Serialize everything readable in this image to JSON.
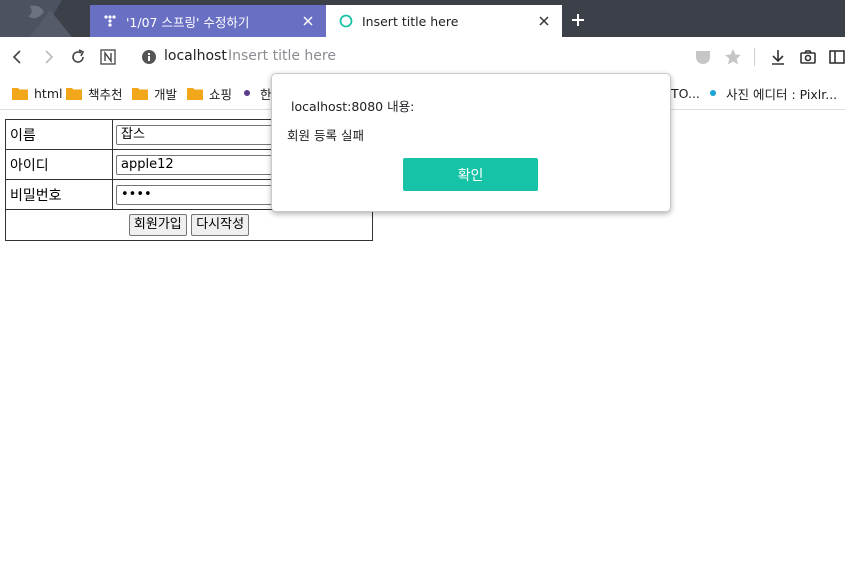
{
  "browser": {
    "tabs": [
      {
        "title": "'1/07 스프링' 수정하기",
        "active": false
      },
      {
        "title": "Insert title here",
        "active": true
      }
    ],
    "address": {
      "host": "localhost",
      "title": "Insert title here"
    },
    "bookmarks": [
      {
        "label": "html",
        "type": "folder"
      },
      {
        "label": "책추천",
        "type": "folder"
      },
      {
        "label": "개발",
        "type": "folder"
      },
      {
        "label": "쇼핑",
        "type": "folder"
      },
      {
        "label": "한",
        "type": "link",
        "color": "#5b3b8c"
      },
      {
        "label": "TO...",
        "type": "link"
      },
      {
        "label": "사진 에디터 : Pixlr...",
        "type": "link",
        "color": "#1aa3d6"
      }
    ]
  },
  "form": {
    "name_label": "이름",
    "name_value": "잡스",
    "id_label": "아이디",
    "id_value": "apple12",
    "password_label": "비밀번호",
    "password_value": "••••",
    "signup_button": "회원가입",
    "reset_button": "다시작성"
  },
  "dialog": {
    "title": "localhost:8080 내용:",
    "message": "회원 등록 실패",
    "ok_button": "확인",
    "accent_color": "#17c3a6"
  },
  "colors": {
    "tabbar": "#3c4049",
    "inactive_tab": "#6970c4"
  }
}
